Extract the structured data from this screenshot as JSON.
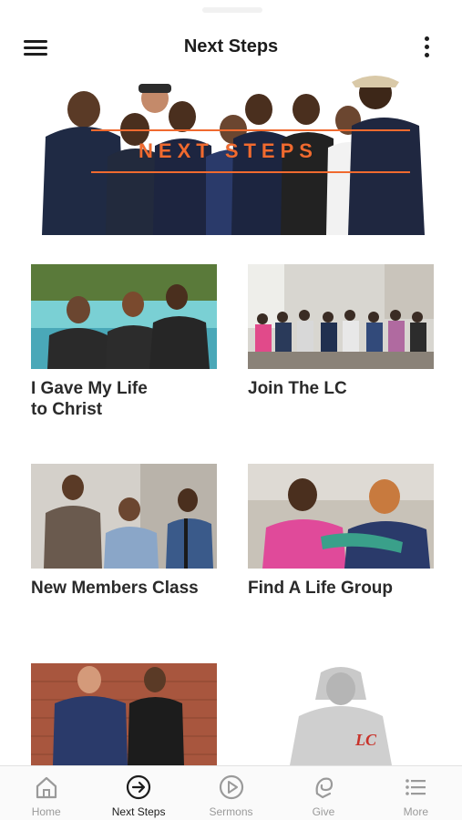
{
  "header": {
    "title": "Next Steps"
  },
  "hero": {
    "overlay_text": "NEXT STEPS"
  },
  "cards": [
    {
      "label": "I Gave My Life\nto Christ"
    },
    {
      "label": "Join The LC"
    },
    {
      "label": "New Members Class"
    },
    {
      "label": "Find A Life Group"
    },
    {
      "label": ""
    },
    {
      "label": ""
    }
  ],
  "merch": {
    "logo_text": "LC"
  },
  "tabbar": {
    "active": "Next Steps",
    "tabs": [
      {
        "label": "Home",
        "icon": "home-icon"
      },
      {
        "label": "Next Steps",
        "icon": "arrow-circle-icon"
      },
      {
        "label": "Sermons",
        "icon": "play-circle-icon"
      },
      {
        "label": "Give",
        "icon": "give-icon"
      },
      {
        "label": "More",
        "icon": "list-icon"
      }
    ]
  },
  "colors": {
    "accent": "#f06a2f",
    "active_tab": "#1c1c1c",
    "inactive_tab": "#9a9a9a",
    "text": "#1c1c1c"
  }
}
